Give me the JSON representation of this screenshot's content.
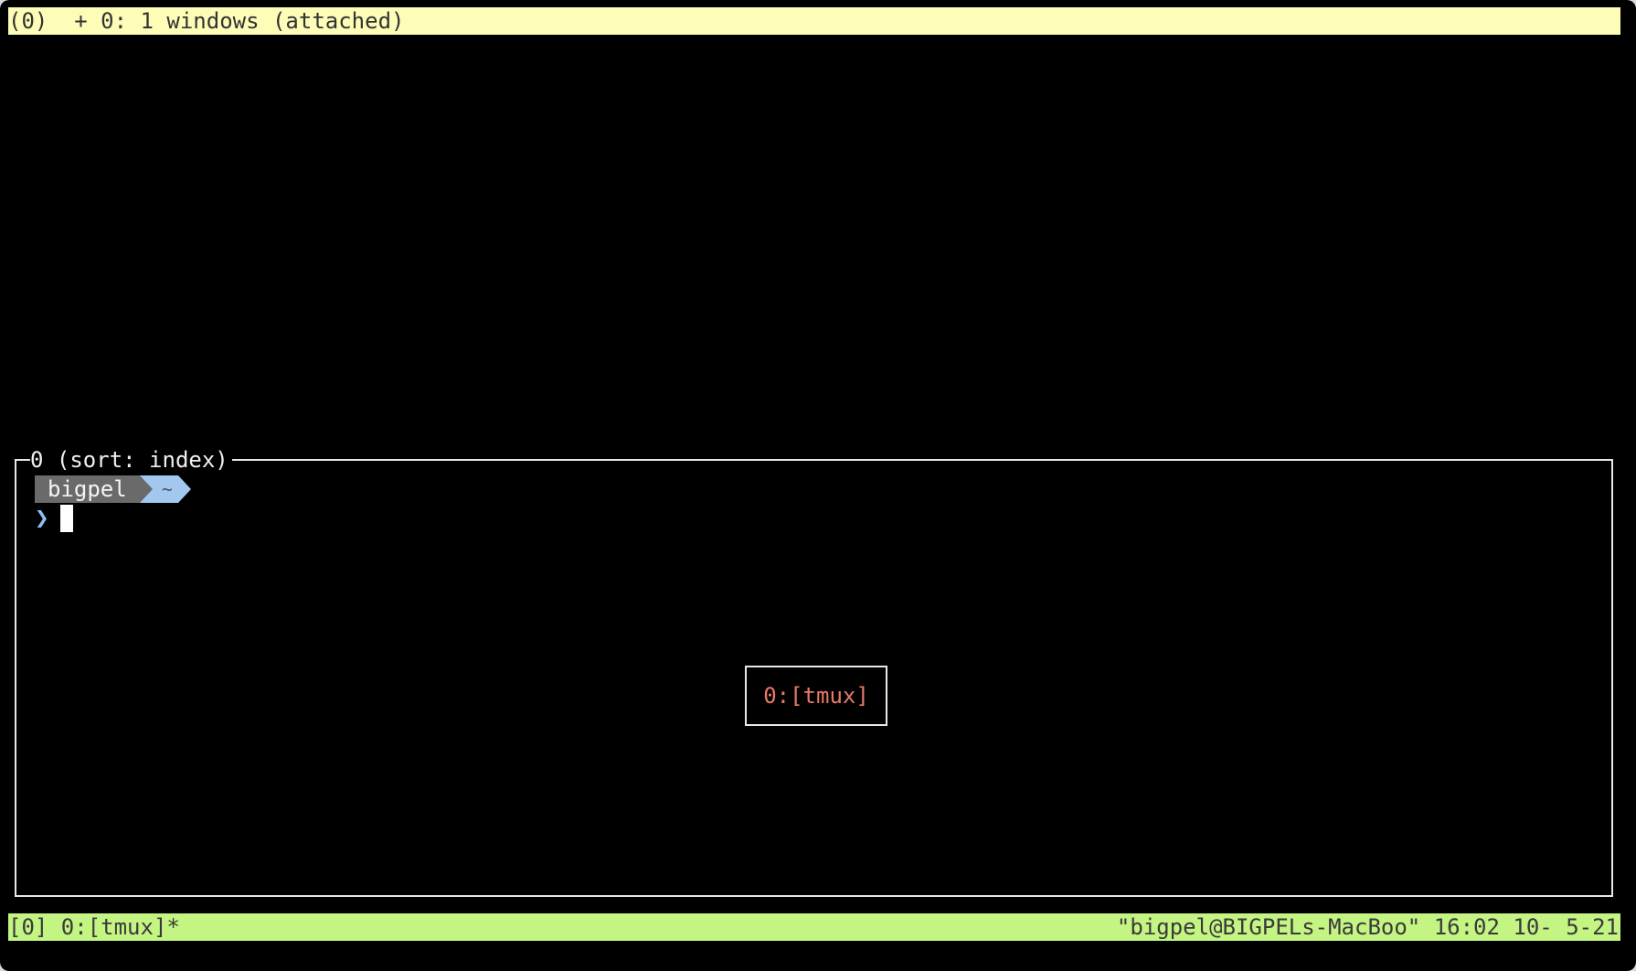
{
  "tree_header": {
    "session_line": "(0)  + 0: 1 windows (attached)"
  },
  "preview": {
    "title": "0 (sort: index)",
    "prompt_user": "bigpel",
    "prompt_dir": "~",
    "prompt_symbol": "❯",
    "window_label": "0:[tmux]"
  },
  "status_bar": {
    "left": "[0] 0:[tmux]*",
    "right": "\"bigpel@BIGPELs-MacBoo\" 16:02 10- 5-21"
  },
  "colors": {
    "header_bg": "#fdfdb8",
    "status_bg": "#c4f582",
    "window_label": "#e8796b",
    "prompt_dir_bg": "#a3c8f0",
    "prompt_user_bg": "#6a6a6a"
  }
}
